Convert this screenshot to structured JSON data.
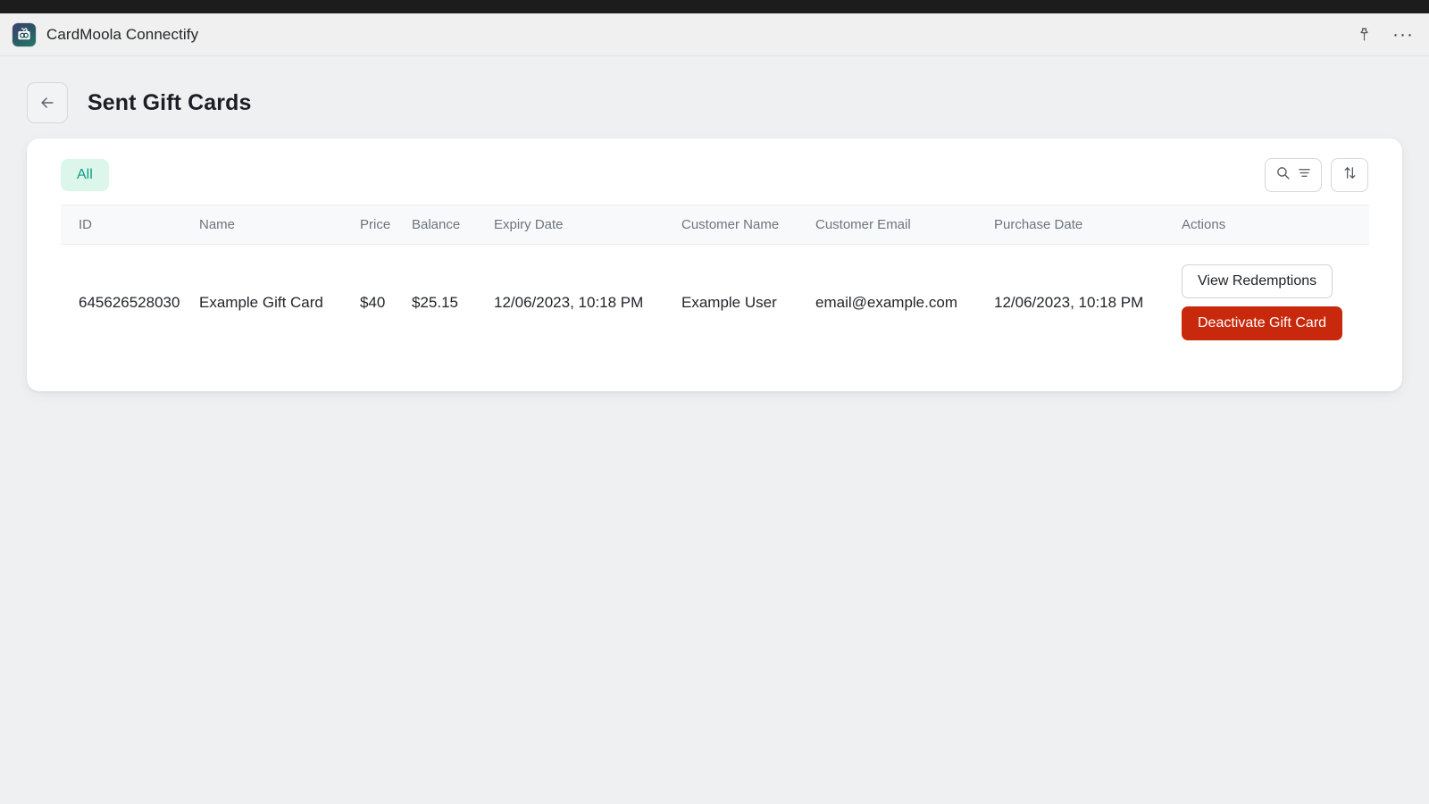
{
  "window": {
    "app_title": "CardMoola Connectify",
    "app_icon": "gift-card-icon",
    "pin_icon": "pin-icon",
    "more_icon": "ellipsis-icon",
    "more_label": "···"
  },
  "header": {
    "back_icon": "arrow-left-icon",
    "title": "Sent Gift Cards"
  },
  "toolbar": {
    "tabs": [
      {
        "label": "All",
        "active": true
      }
    ],
    "search_icon": "search-icon",
    "filter_icon": "filter-lines-icon",
    "sort_icon": "sort-arrows-icon"
  },
  "table": {
    "columns": [
      "ID",
      "Name",
      "Price",
      "Balance",
      "Expiry Date",
      "Customer Name",
      "Customer Email",
      "Purchase Date",
      "Actions"
    ],
    "rows": [
      {
        "id": "645626528030",
        "name": "Example Gift Card",
        "price": "$40",
        "balance": "$25.15",
        "expiry_date": "12/06/2023, 10:18 PM",
        "customer_name": "Example User",
        "customer_email": "email@example.com",
        "purchase_date": "12/06/2023, 10:18 PM",
        "actions": {
          "view_redemptions": "View Redemptions",
          "deactivate": "Deactivate Gift Card"
        }
      }
    ]
  },
  "colors": {
    "page_background": "#eff0f2",
    "card_background": "#ffffff",
    "tab_active_background": "#ddf6ec",
    "tab_active_text": "#0f9b82",
    "danger_button": "#c8290c",
    "titlebar_strip": "#1c1c1c"
  }
}
